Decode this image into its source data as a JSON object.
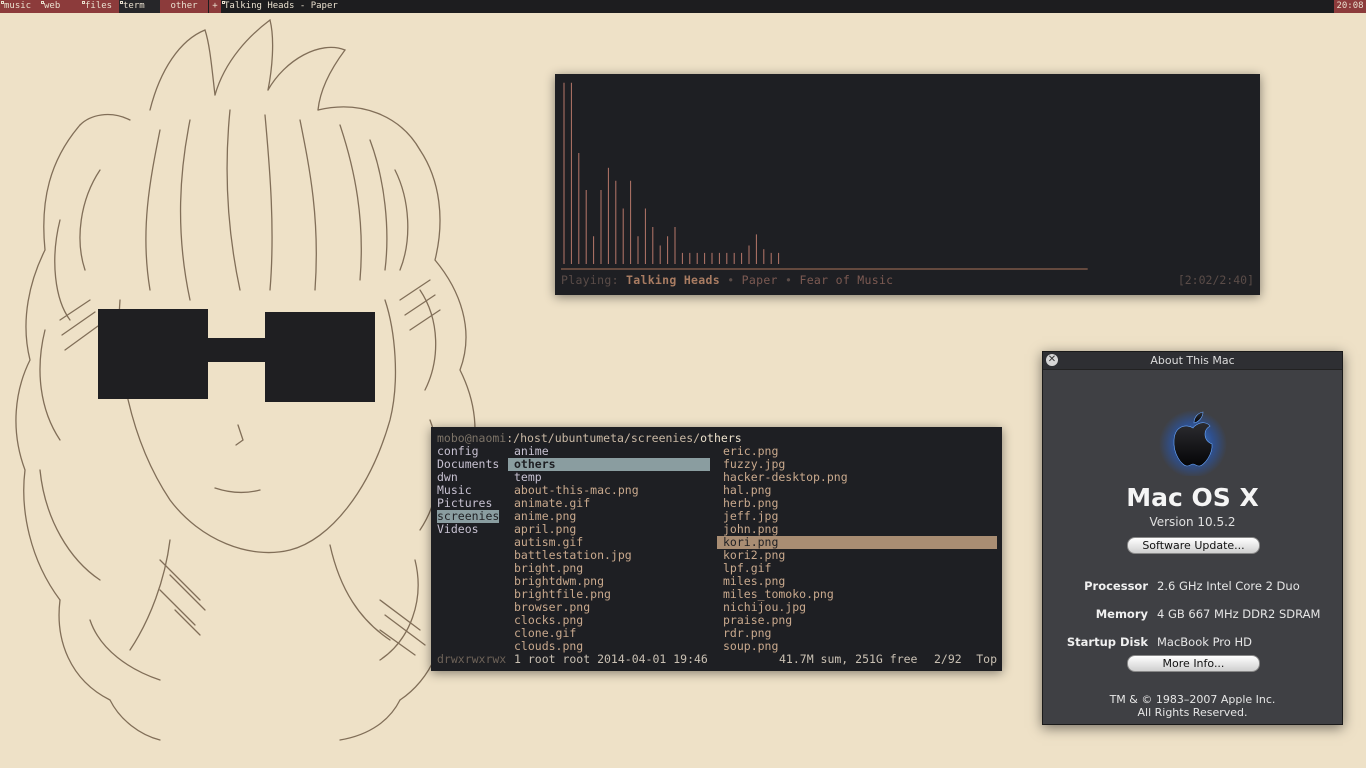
{
  "topbar": {
    "tags": [
      "music",
      "web",
      "files",
      "term",
      "other"
    ],
    "plus_label": "+",
    "window_title": "Talking Heads - Paper",
    "clock": "20:08",
    "colors": {
      "bar": "#1d1d1f",
      "occupied": "#8c3b3b"
    }
  },
  "visualizer": {
    "playing_label": "Playing:",
    "artist": "Talking Heads",
    "separator": "•",
    "track": "Paper",
    "album": "Fear of Music",
    "time": "[2:02/2:40]",
    "progress": 0.76,
    "bars": [
      0.98,
      0.98,
      0.6,
      0.4,
      0.15,
      0.4,
      0.52,
      0.45,
      0.3,
      0.45,
      0.15,
      0.3,
      0.2,
      0.1,
      0.15,
      0.2,
      0.06,
      0.06,
      0.06,
      0.06,
      0.06,
      0.06,
      0.06,
      0.06,
      0.06,
      0.1,
      0.16,
      0.08,
      0.06,
      0.06
    ],
    "bar_color": "#b6776a"
  },
  "file_manager": {
    "path_user": "mobo@naomi",
    "path_dir": ":/host/ubuntumeta/screenies/",
    "path_current": "others",
    "col1": [
      "config",
      "Documents",
      "dwn",
      "Music",
      "Pictures",
      "screenies",
      "Videos"
    ],
    "col1_selected": 5,
    "col2": [
      "anime",
      "others",
      "temp",
      "about-this-mac.png",
      "animate.gif",
      "anime.png",
      "april.png",
      "autism.gif",
      "battlestation.jpg",
      "bright.png",
      "brightdwm.png",
      "brightfile.png",
      "browser.png",
      "clocks.png",
      "clone.gif",
      "clouds.png"
    ],
    "col2_dirs": 3,
    "col2_selected": 1,
    "col3": [
      "eric.png",
      "fuzzy.jpg",
      "hacker-desktop.png",
      "hal.png",
      "herb.png",
      "jeff.jpg",
      "john.png",
      "kori.png",
      "kori2.png",
      "lpf.gif",
      "miles.png",
      "miles_tomoko.png",
      "nichijou.jpg",
      "praise.png",
      "rdr.png",
      "soup.png"
    ],
    "col3_selected": 7,
    "status": {
      "perms": "drwxrwxrwx",
      "info": "1 root root 2014-04-01 19:46",
      "sum": "41.7M sum, 251G free",
      "pos": "2/92",
      "scroll": "Top"
    }
  },
  "about_mac": {
    "title": "About This Mac",
    "close_glyph": "✕",
    "os_name": "Mac OS X",
    "version": "Version 10.5.2",
    "update_button": "Software Update...",
    "specs": [
      {
        "label": "Processor",
        "value": "2.6 GHz Intel Core 2 Duo"
      },
      {
        "label": "Memory",
        "value": "4 GB 667 MHz DDR2 SDRAM"
      },
      {
        "label": "Startup Disk",
        "value": "MacBook Pro HD"
      }
    ],
    "more_button": "More Info...",
    "copyright_line1": "TM & © 1983–2007 Apple Inc.",
    "copyright_line2": "All Rights Reserved."
  },
  "icons": [
    "apple-logo-icon",
    "close-icon",
    "tag-marker-icon"
  ]
}
